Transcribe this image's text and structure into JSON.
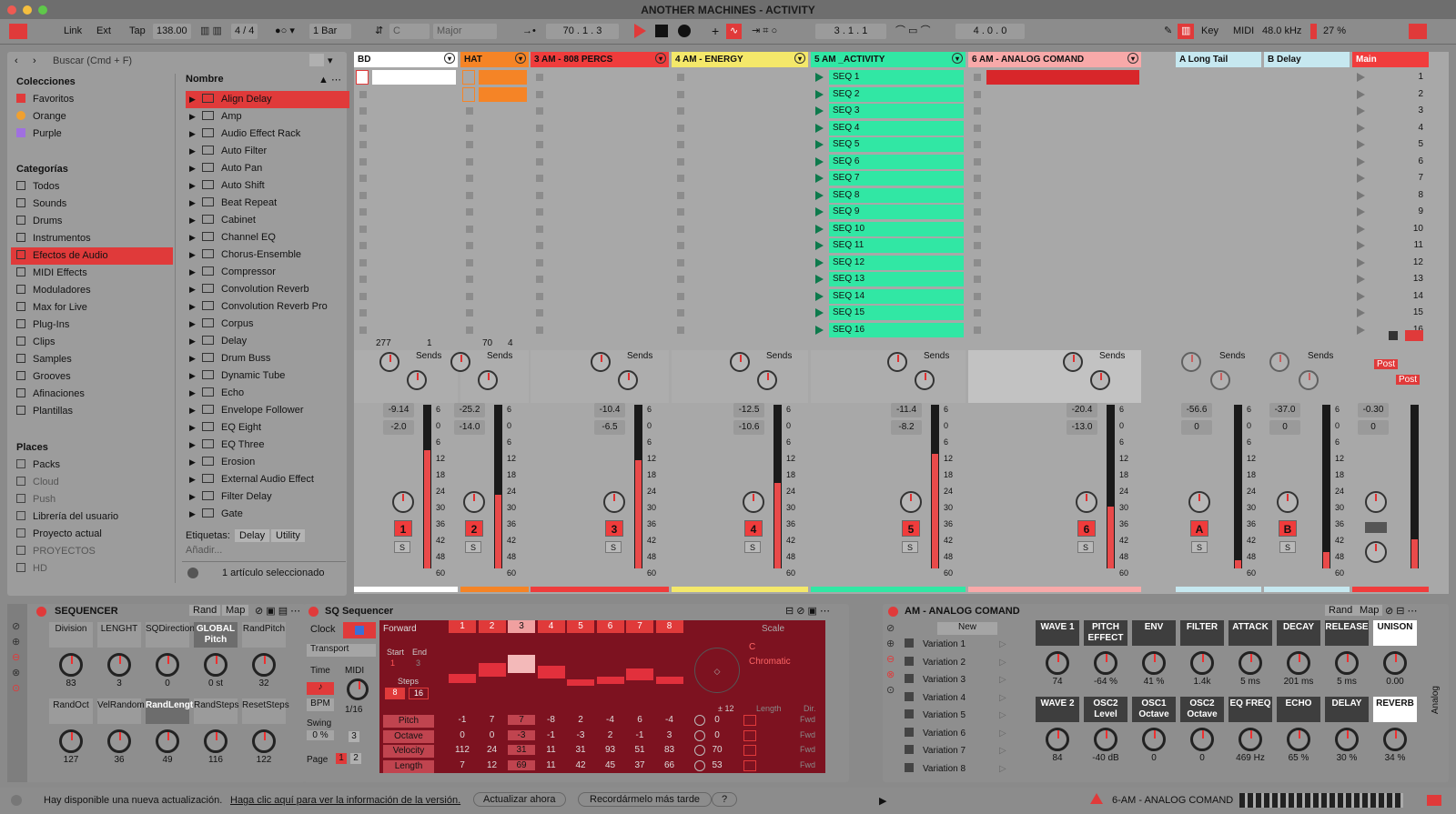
{
  "window": {
    "title": "ANOTHER MACHINES - ACTIVITY"
  },
  "transport": {
    "link": "Link",
    "ext": "Ext",
    "tap": "Tap",
    "tempo": "138.00",
    "signature": "4 / 4",
    "quantize": "1 Bar",
    "key": "C",
    "scale": "Major",
    "position": "70 .  1 .  3",
    "loop_start": "3 .  1 .  1",
    "loop_length": "4 .  0 .  0",
    "key_label": "Key",
    "midi_label": "MIDI",
    "sample_rate": "48.0 kHz",
    "cpu": "27 %"
  },
  "browser": {
    "search_placeholder": "Buscar (Cmd + F)",
    "collections_title": "Colecciones",
    "collections": [
      {
        "label": "Favoritos",
        "color": "#e03a3a"
      },
      {
        "label": "Orange",
        "color": "#f0a030"
      },
      {
        "label": "Purple",
        "color": "#a070e0"
      }
    ],
    "categories_title": "Categorías",
    "categories": [
      "Todos",
      "Sounds",
      "Drums",
      "Instrumentos",
      "Efectos de Audio",
      "MIDI Effects",
      "Moduladores",
      "Max for Live",
      "Plug-Ins",
      "Clips",
      "Samples",
      "Grooves",
      "Afinaciones",
      "Plantillas"
    ],
    "places_title": "Places",
    "places": [
      "Packs",
      "Cloud",
      "Push",
      "Librería del usuario",
      "Proyecto actual",
      "PROYECTOS",
      "HD"
    ],
    "name_header": "Nombre",
    "items": [
      "Align Delay",
      "Amp",
      "Audio Effect Rack",
      "Auto Filter",
      "Auto Pan",
      "Auto Shift",
      "Beat Repeat",
      "Cabinet",
      "Channel EQ",
      "Chorus-Ensemble",
      "Compressor",
      "Convolution Reverb",
      "Convolution Reverb Pro",
      "Corpus",
      "Delay",
      "Drum Buss",
      "Dynamic Tube",
      "Echo",
      "Envelope Follower",
      "EQ Eight",
      "EQ Three",
      "Erosion",
      "External Audio Effect",
      "Filter Delay",
      "Gate"
    ],
    "tags_label": "Etiquetas:",
    "tags": [
      "Delay",
      "Utility"
    ],
    "add_label": "Añadir...",
    "selected_info": "1 artículo seleccionado"
  },
  "tracks": [
    {
      "name": "BD",
      "color": "#ffffff",
      "num": "1",
      "vol": "-9.14",
      "pan": "-2.0",
      "meter": 0.72,
      "ctrl_a": "277",
      "ctrl_b": "1"
    },
    {
      "name": "HAT",
      "color": "#f58426",
      "num": "2",
      "vol": "-25.2",
      "pan": "-14.0",
      "meter": 0.45,
      "ctrl_a": "70",
      "ctrl_b": "4"
    },
    {
      "name": "3 AM - 808 PERCS",
      "color": "#ef3c3c",
      "num": "3",
      "vol": "-10.4",
      "pan": "-6.5",
      "meter": 0.66
    },
    {
      "name": "4 AM - ENERGY",
      "color": "#f4e86a",
      "num": "4",
      "vol": "-12.5",
      "pan": "-10.6",
      "meter": 0.52
    },
    {
      "name": "5 AM _ACTIVITY",
      "color": "#31e7a4",
      "num": "5",
      "vol": "-11.4",
      "pan": "-8.2",
      "meter": 0.7
    },
    {
      "name": "6 AM - ANALOG COMAND",
      "color": "#f8a9a9",
      "num": "6",
      "vol": "-20.4",
      "pan": "-13.0",
      "meter": 0.38
    }
  ],
  "returns": [
    {
      "name": "A Long Tail",
      "num": "A",
      "vol": "-56.6",
      "pan": "0",
      "meter": 0.05
    },
    {
      "name": "B Delay",
      "num": "B",
      "vol": "-37.0",
      "pan": "0",
      "meter": 0.1
    },
    {
      "name": "Main",
      "vol": "-0.30",
      "pan": "0",
      "meter": 0.18
    }
  ],
  "sends_label": "Sends",
  "post_label": "Post",
  "solo_label": "S",
  "meter_scale": [
    "6",
    "0",
    "6",
    "12",
    "18",
    "24",
    "30",
    "36",
    "42",
    "48",
    "60"
  ],
  "seq_clips": [
    "SEQ 1",
    "SEQ 2",
    "SEQ 3",
    "SEQ 4",
    "SEQ 5",
    "SEQ 6",
    "SEQ 7",
    "SEQ 8",
    "SEQ 9",
    "SEQ 10",
    "SEQ 11",
    "SEQ 12",
    "SEQ 13",
    "SEQ 14",
    "SEQ 15",
    "SEQ 16"
  ],
  "scenes": [
    "1",
    "2",
    "3",
    "4",
    "5",
    "6",
    "7",
    "8",
    "9",
    "10",
    "11",
    "12",
    "13",
    "14",
    "15",
    "16"
  ],
  "sequencer": {
    "title": "SEQUENCER",
    "rand": "Rand",
    "map": "Map",
    "params": [
      {
        "label": "Division",
        "value": "83"
      },
      {
        "label": "LENGHT",
        "value": "3"
      },
      {
        "label": "SQDirection",
        "value": "0"
      },
      {
        "label": "GLOBAL Pitch",
        "value": "0 st"
      },
      {
        "label": "RandPitch",
        "value": "32"
      },
      {
        "label": "RandOct",
        "value": "127"
      },
      {
        "label": "VelRandom",
        "value": "36"
      },
      {
        "label": "RandLength",
        "value": "49"
      },
      {
        "label": "RandSteps",
        "value": "116"
      },
      {
        "label": "ResetSteps",
        "value": "122"
      }
    ]
  },
  "sq": {
    "title": "SQ Sequencer",
    "clock": "Clock",
    "transport": "Transport",
    "time": "Time",
    "midi": "MIDI",
    "bpm": "BPM",
    "swing": "Swing",
    "swing_val": "0 %",
    "rate": "1/16",
    "forward": "Forward",
    "start": "Start",
    "end": "End",
    "start_val": "1",
    "end_val": "3",
    "steps": "Steps",
    "steps_a": "8",
    "steps_b": "16",
    "page": "Page",
    "page1": "1",
    "page2": "2",
    "steps_n": [
      "1",
      "2",
      "3",
      "4",
      "5",
      "6",
      "7",
      "8"
    ],
    "rows": [
      {
        "label": "Pitch",
        "values": [
          "-1",
          "7",
          "7",
          "-8",
          "2",
          "-4",
          "6",
          "-4"
        ],
        "extra": "0"
      },
      {
        "label": "Octave",
        "values": [
          "0",
          "0",
          "-3",
          "-1",
          "-3",
          "2",
          "-1",
          "3"
        ],
        "extra": "0"
      },
      {
        "label": "Velocity",
        "values": [
          "112",
          "24",
          "31",
          "11",
          "31",
          "93",
          "51",
          "83"
        ],
        "extra": "70"
      },
      {
        "label": "Length",
        "values": [
          "7",
          "12",
          "69",
          "11",
          "42",
          "45",
          "37",
          "66"
        ],
        "extra": "53"
      }
    ],
    "scale_label": "Scale",
    "root": "C",
    "mode": "Chromatic",
    "range": "± 12",
    "length_label": "Length",
    "dir_label": "Dir.",
    "fwd": "Fwd",
    "three": "3"
  },
  "analog": {
    "title": "AM - ANALOG COMAND",
    "new": "New",
    "rand": "Rand",
    "map": "Map",
    "variations": [
      "Variation 1",
      "Variation 2",
      "Variation 3",
      "Variation 4",
      "Variation 5",
      "Variation 6",
      "Variation 7",
      "Variation 8"
    ],
    "params": [
      {
        "label": "WAVE 1",
        "value": "74"
      },
      {
        "label": "PITCH EFFECT",
        "value": "-64 %"
      },
      {
        "label": "ENV",
        "value": "41 %"
      },
      {
        "label": "FILTER",
        "value": "1.4k"
      },
      {
        "label": "ATTACK",
        "value": "5 ms"
      },
      {
        "label": "DECAY",
        "value": "201 ms"
      },
      {
        "label": "RELEASE",
        "value": "5 ms"
      },
      {
        "label": "UNISON",
        "value": "0.00"
      },
      {
        "label": "WAVE 2",
        "value": "84"
      },
      {
        "label": "OSC2 Level",
        "value": "-40 dB"
      },
      {
        "label": "OSC1 Octave",
        "value": "0"
      },
      {
        "label": "OSC2 Octave",
        "value": "0"
      },
      {
        "label": "EQ FREQ",
        "value": "469 Hz"
      },
      {
        "label": "ECHO",
        "value": "65 %"
      },
      {
        "label": "DELAY",
        "value": "30 %"
      },
      {
        "label": "REVERB",
        "value": "34 %"
      }
    ],
    "side_label": "Analog"
  },
  "status": {
    "message": "Hay disponible una nueva actualización.",
    "link": "Haga clic aquí para ver la información de la versión.",
    "update_now": "Actualizar ahora",
    "remind": "Recordármelo más tarde",
    "help": "?",
    "selected_track": "6-AM - ANALOG COMAND"
  }
}
